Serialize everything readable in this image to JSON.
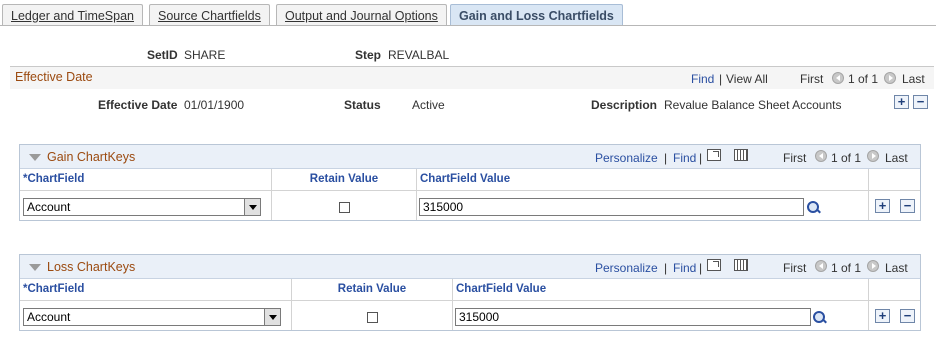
{
  "tabs": [
    {
      "label": "Ledger and TimeSpan",
      "active": false
    },
    {
      "label": "Source Chartfields",
      "active": false
    },
    {
      "label": "Output and Journal Options",
      "active": false
    },
    {
      "label": "Gain and Loss Chartfields",
      "active": true
    }
  ],
  "header": {
    "setid_label": "SetID",
    "setid_value": "SHARE",
    "step_label": "Step",
    "step_value": "REVALBAL"
  },
  "effective_date": {
    "title": "Effective Date",
    "find": "Find",
    "sep": "|",
    "view_all": "View All",
    "first": "First",
    "counter": "1 of 1",
    "last": "Last",
    "date_label": "Effective Date",
    "date_value": "01/01/1900",
    "status_label": "Status",
    "status_value": "Active",
    "desc_label": "Description",
    "desc_value": "Revalue Balance Sheet Accounts",
    "add": "+",
    "remove": "−"
  },
  "gain_grid": {
    "title": "Gain ChartKeys",
    "personalize": "Personalize",
    "sep": "|",
    "find": "Find",
    "sep2": "|",
    "first": "First",
    "counter": "1 of 1",
    "last": "Last",
    "col_chartfield": "*ChartField",
    "col_retain": "Retain Value",
    "col_value": "ChartField Value",
    "row": {
      "chartfield": "Account",
      "retain": false,
      "value": "315000"
    },
    "add": "+",
    "remove": "−"
  },
  "loss_grid": {
    "title": "Loss ChartKeys",
    "personalize": "Personalize",
    "sep": "|",
    "find": "Find",
    "sep2": "|",
    "first": "First",
    "counter": "1 of 1",
    "last": "Last",
    "col_chartfield": "*ChartField",
    "col_retain": "Retain Value",
    "col_value": "ChartField Value",
    "row": {
      "chartfield": "Account",
      "retain": false,
      "value": "315000"
    },
    "add": "+",
    "remove": "−"
  }
}
